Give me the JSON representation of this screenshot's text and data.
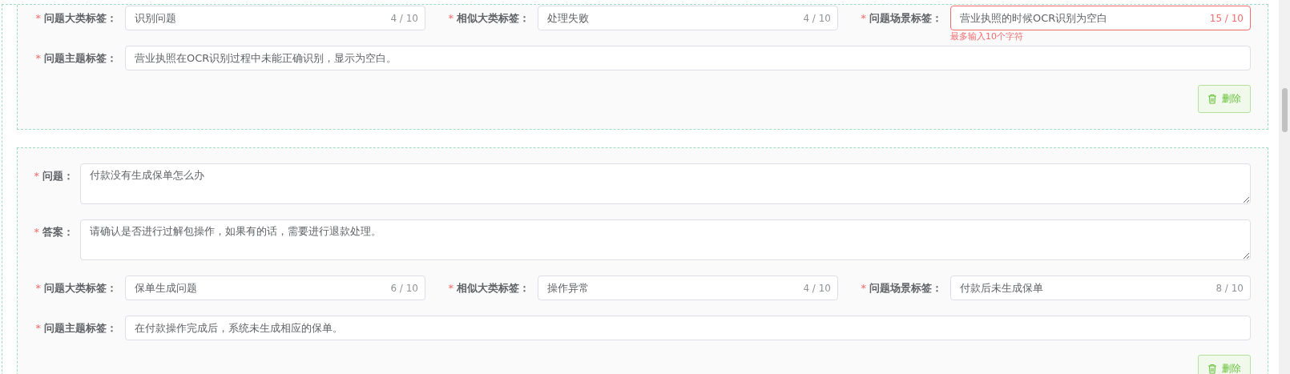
{
  "cards": [
    {
      "rows": [
        [
          {
            "kind": "input",
            "required_mark": "*",
            "label": "问题大类标签：",
            "value": "识别问题",
            "count": "4 / 10",
            "invalid": false
          },
          {
            "kind": "input",
            "required_mark": "*",
            "label": "相似大类标签：",
            "value": "处理失败",
            "count": "4 / 10",
            "invalid": false
          },
          {
            "kind": "input",
            "required_mark": "*",
            "label": "问题场景标签：",
            "value": "营业执照的时候OCR识别为空白",
            "count": "15 / 10",
            "invalid": true,
            "error": "最多输入10个字符"
          }
        ],
        [
          {
            "kind": "input",
            "required_mark": "*",
            "label": "问题主题标签：",
            "value": "营业执照在OCR识别过程中未能正确识别，显示为空白。",
            "invalid": false
          }
        ]
      ],
      "delete_button": "删除"
    },
    {
      "rows": [
        [
          {
            "kind": "textarea",
            "required_mark": "*",
            "label": "问题：",
            "value": "付款没有生成保单怎么办",
            "invalid": false
          }
        ],
        [
          {
            "kind": "textarea",
            "required_mark": "*",
            "label": "答案：",
            "value": "请确认是否进行过解包操作，如果有的话，需要进行退款处理。",
            "invalid": false
          }
        ],
        [
          {
            "kind": "input",
            "required_mark": "*",
            "label": "问题大类标签：",
            "value": "保单生成问题",
            "count": "6 / 10",
            "invalid": false
          },
          {
            "kind": "input",
            "required_mark": "*",
            "label": "相似大类标签：",
            "value": "操作异常",
            "count": "4 / 10",
            "invalid": false
          },
          {
            "kind": "input",
            "required_mark": "*",
            "label": "问题场景标签：",
            "value": "付款后未生成保单",
            "count": "8 / 10",
            "invalid": false
          }
        ],
        [
          {
            "kind": "input",
            "required_mark": "*",
            "label": "问题主题标签：",
            "value": "在付款操作完成后，系统未生成相应的保单。",
            "invalid": false
          }
        ]
      ],
      "delete_button": "删除"
    }
  ]
}
